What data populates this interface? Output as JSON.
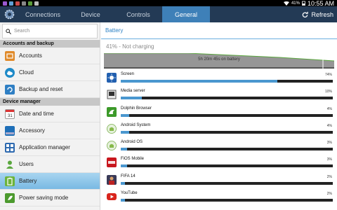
{
  "status_bar": {
    "battery_pct": "41%",
    "time": "10:55 AM"
  },
  "tabs": [
    {
      "label": "Connections"
    },
    {
      "label": "Device"
    },
    {
      "label": "Controls"
    },
    {
      "label": "General",
      "active": true
    }
  ],
  "refresh_label": "Refresh",
  "search_placeholder": "Search",
  "sidebar": {
    "section_1": "Accounts and backup",
    "section_2": "Device manager",
    "items": [
      {
        "label": "Accounts",
        "icon": "accounts-icon"
      },
      {
        "label": "Cloud",
        "icon": "cloud-icon"
      },
      {
        "label": "Backup and reset",
        "icon": "backup-icon"
      },
      {
        "label": "Date and time",
        "icon": "calendar-icon"
      },
      {
        "label": "Accessory",
        "icon": "accessory-icon"
      },
      {
        "label": "Application manager",
        "icon": "apps-icon"
      },
      {
        "label": "Users",
        "icon": "user-icon"
      },
      {
        "label": "Battery",
        "icon": "battery-icon",
        "active": true
      },
      {
        "label": "Power saving mode",
        "icon": "power-saving-icon"
      }
    ]
  },
  "main": {
    "title": "Battery",
    "status": "41% - Not charging",
    "graph_label": "5h 20m 45s on battery"
  },
  "apps": [
    {
      "name": "Screen",
      "pct": "74%",
      "level": 0.74,
      "icon": "screen-brightness-icon"
    },
    {
      "name": "Media server",
      "pct": "10%",
      "level": 0.1,
      "icon": "media-server-icon"
    },
    {
      "name": "Dolphin Browser",
      "pct": "4%",
      "level": 0.04,
      "icon": "dolphin-icon"
    },
    {
      "name": "Android System",
      "pct": "4%",
      "level": 0.04,
      "icon": "android-icon"
    },
    {
      "name": "Android OS",
      "pct": "3%",
      "level": 0.03,
      "icon": "android-icon"
    },
    {
      "name": "FiOS Mobile",
      "pct": "3%",
      "level": 0.03,
      "icon": "fios-icon"
    },
    {
      "name": "FIFA 14",
      "pct": "2%",
      "level": 0.02,
      "icon": "fifa-icon"
    },
    {
      "name": "YouTube",
      "pct": "2%",
      "level": 0.02,
      "icon": "youtube-icon"
    }
  ],
  "colors": {
    "accent": "#3e80b8",
    "topbar": "#233a55",
    "bar_fill": "#4a97cf",
    "title": "#2b80c4"
  }
}
